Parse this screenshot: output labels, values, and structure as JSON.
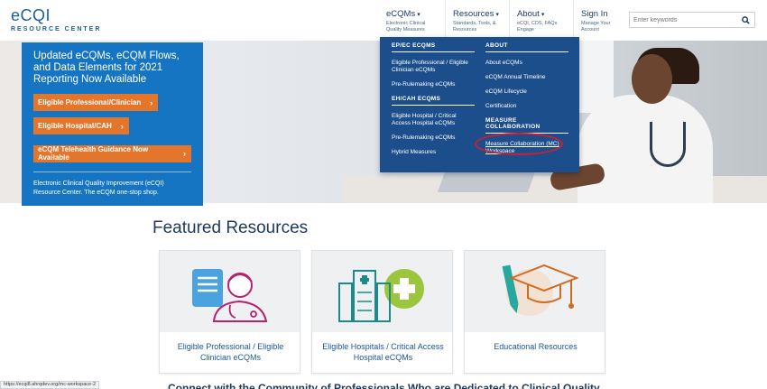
{
  "logo": {
    "main": "eCQI",
    "sub": "RESOURCE CENTER"
  },
  "nav": [
    {
      "label": "eCQMs",
      "sub": "Electronic Clinical Quality Measures"
    },
    {
      "label": "Resources",
      "sub": "Standards, Tools, & Resources"
    },
    {
      "label": "About",
      "sub": "eCQI, CDS, FAQs Engage"
    },
    {
      "label": "Sign In",
      "sub": "Manage Your Account"
    }
  ],
  "search": {
    "placeholder": "Enter keywords",
    "icon": "search-icon"
  },
  "hero": {
    "heading": "Updated eCQMs, eCQM Flows, and Data Elements for 2021 Reporting Now Available",
    "buttons": [
      "Eligible Professional/Clinician",
      "Eligible Hospital/CAH",
      "eCQM Telehealth Guidance Now Available"
    ],
    "description": "Electronic Clinical Quality Improvement (eCQI) Resource Center. The eCQM one-stop shop."
  },
  "dropdown": {
    "left": {
      "heading1": "EP/EC ECQMS",
      "links1": [
        "Eligible Professional / Eligible Clinician eCQMs",
        "Pre-Rulemaking eCQMs"
      ],
      "heading2": "EH/CAH ECQMS",
      "links2": [
        "Eligible Hospital / Critical Access Hospital eCQMs",
        "Pre-Rulemaking eCQMs",
        "Hybrid Measures"
      ]
    },
    "right": {
      "heading1": "ABOUT",
      "links1": [
        "About eCQMs",
        "eCQM Annual Timeline",
        "eCQM Lifecycle",
        "Certification"
      ],
      "heading2": "MEASURE COLLABORATION",
      "links2": [
        "Measure Collaboration (MC) Workspace"
      ]
    }
  },
  "featured": {
    "title": "Featured Resources",
    "cards": [
      {
        "label": "Eligible Professional / Eligible Clinician eCQMs",
        "icon": "clinician-icon"
      },
      {
        "label": "Eligible Hospitals / Critical Access Hospital eCQMs",
        "icon": "hospital-icon"
      },
      {
        "label": "Educational Resources",
        "icon": "graduation-cap-icon"
      }
    ]
  },
  "connect": "Connect with the Community of Professionals Who are Dedicated to Clinical Quality",
  "statusbar": "https://ecqi8.ahrqdev.org/mc-workspace-2",
  "colors": {
    "brand_blue": "#1675c2",
    "nav_blue": "#1c4e8c",
    "orange": "#e3762b",
    "annotation_red": "#cc1f2f"
  }
}
